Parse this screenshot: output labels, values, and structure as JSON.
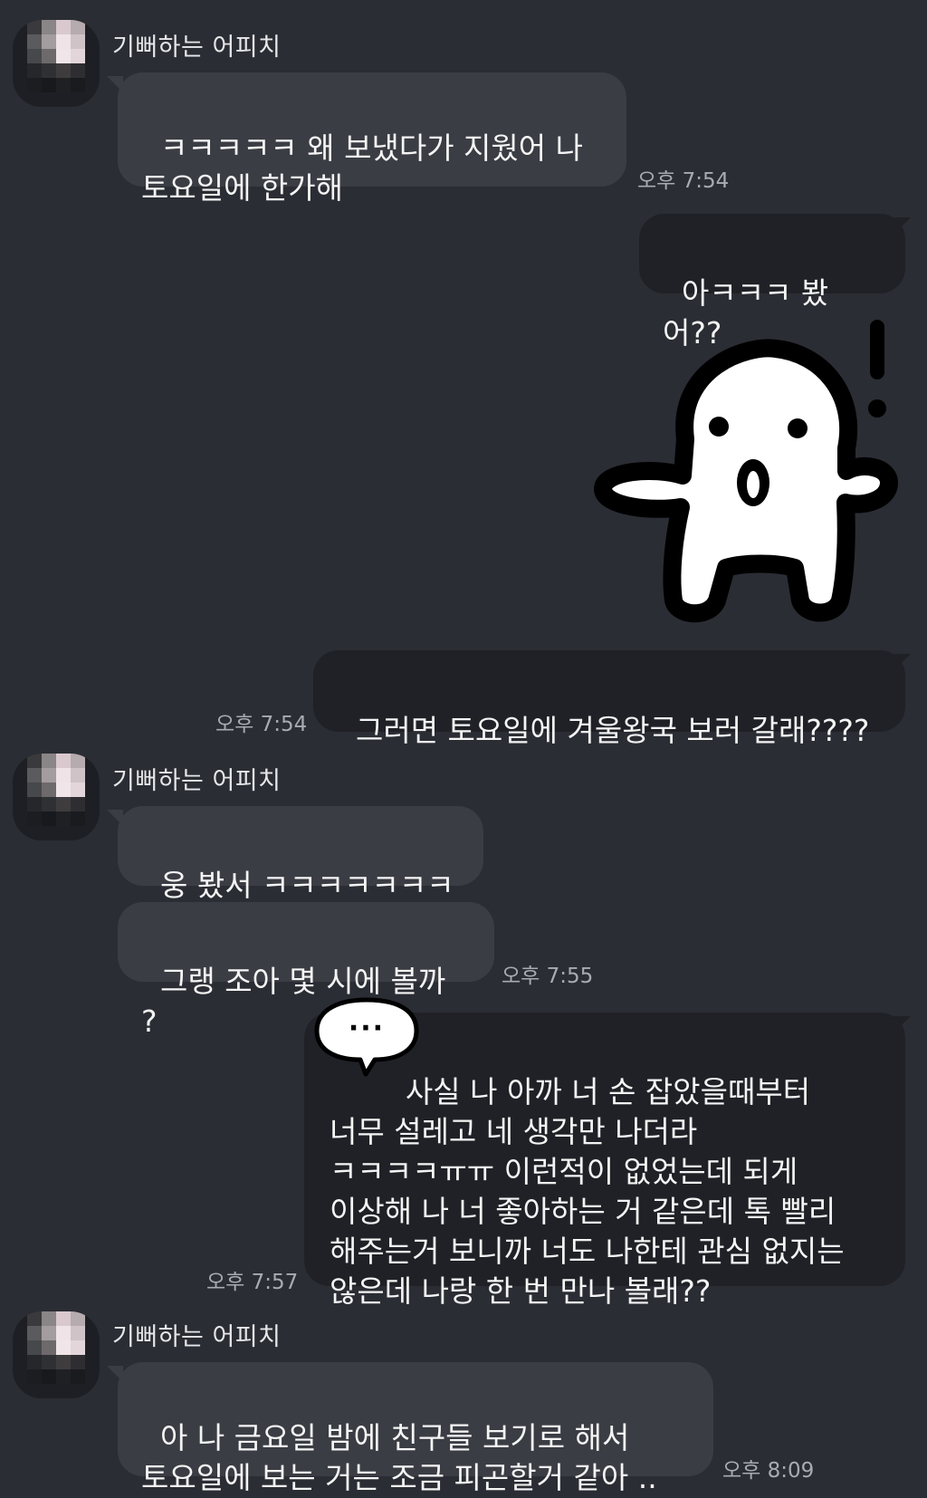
{
  "sender_name": "기뻐하는 어피치",
  "messages": {
    "m1": {
      "text": "ㅋㅋㅋㅋㅋ 왜 보냈다가 지웠어 나\n토요일에 한가해",
      "time": "오후 7:54"
    },
    "m2": {
      "text": "아ㅋㅋㅋ 봤어??"
    },
    "m3": {
      "text": "그러면 토요일에 겨울왕국 보러 갈래????",
      "time": "오후 7:54"
    },
    "m4": {
      "text": "웅 봤서 ㅋㅋㅋㅋㅋㅋㅋ"
    },
    "m5": {
      "text": "그랭 조아 몇 시에 볼까 ?",
      "time": "오후 7:55"
    },
    "m6": {
      "text": "      사실 나 아까 너 손 잡았을때부터\n너무 설레고 네 생각만 나더라\nㅋㅋㅋㅋㅠㅠ 이런적이 없었는데 되게\n이상해 나 너 좋아하는 거 같은데 톡 빨리\n해주는거 보니까 너도 나한테 관심 없지는\n않은데 나랑 한 번 만나 볼래??",
      "time": "오후 7:57"
    },
    "m7": {
      "text": "아 나 금요일 밤에 친구들 보기로 해서\n토요일에 보는 거는 조금 피곤할거 같아 ..",
      "time": "오후 8:09"
    }
  },
  "sticker": {
    "name": "surprised-character-sticker"
  },
  "typing_indicator": {
    "text": "···"
  },
  "colors": {
    "background": "#2b2d34",
    "incoming_bubble": "#3b3d44",
    "outgoing_bubble": "#1f2126",
    "timestamp": "#a9abb1"
  }
}
